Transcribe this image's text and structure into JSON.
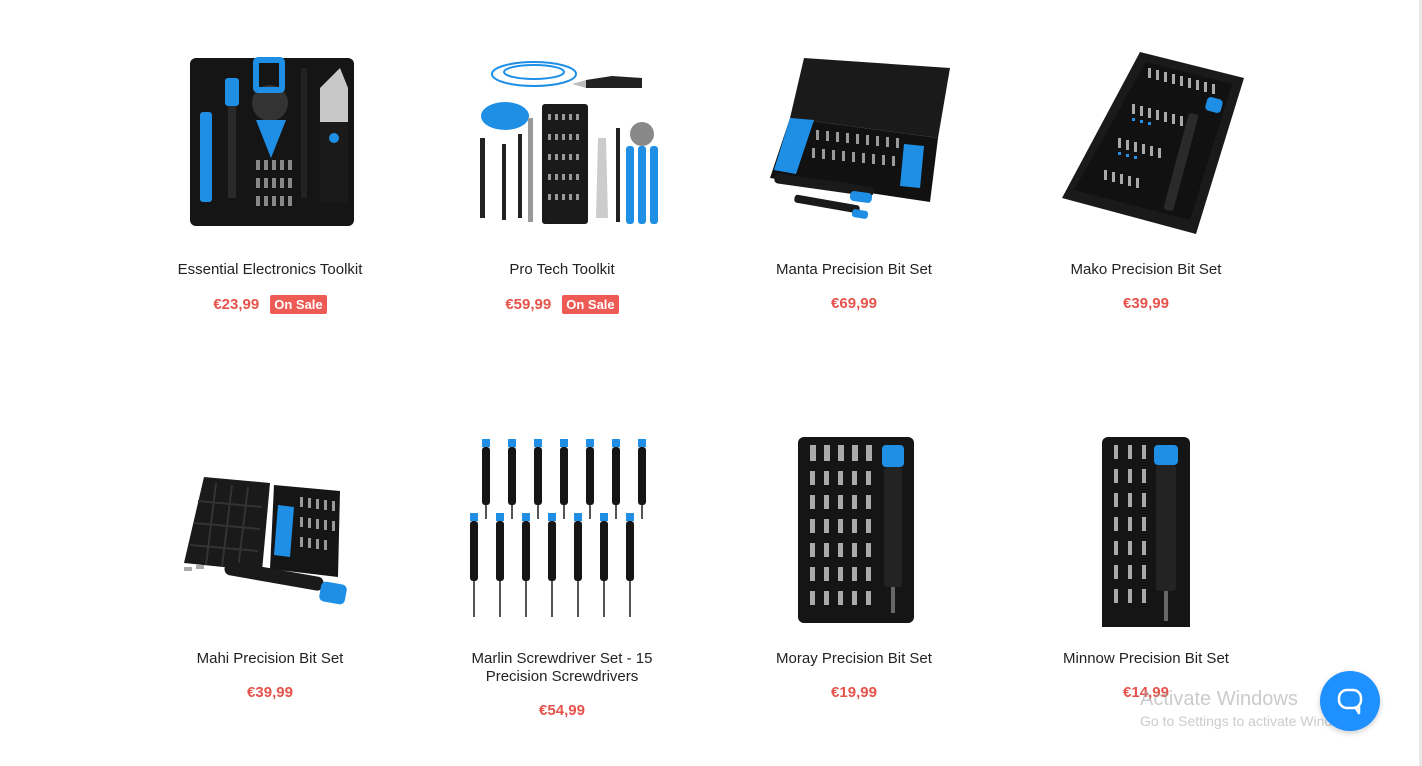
{
  "products": [
    {
      "title": "Essential Electronics Toolkit",
      "price": "€23,99",
      "badge": "On Sale",
      "image": "essential-toolkit"
    },
    {
      "title": "Pro Tech Toolkit",
      "price": "€59,99",
      "badge": "On Sale",
      "image": "pro-tech-toolkit"
    },
    {
      "title": "Manta Precision Bit Set",
      "price": "€69,99",
      "badge": "",
      "image": "manta-bit-set"
    },
    {
      "title": "Mako Precision Bit Set",
      "price": "€39,99",
      "badge": "",
      "image": "mako-bit-set"
    },
    {
      "title": "Mahi Precision Bit Set",
      "price": "€39,99",
      "badge": "",
      "image": "mahi-bit-set"
    },
    {
      "title": "Marlin Screwdriver Set - 15 Precision Screwdrivers",
      "price": "€54,99",
      "badge": "",
      "image": "marlin-screwdriver-set"
    },
    {
      "title": "Moray Precision Bit Set",
      "price": "€19,99",
      "badge": "",
      "image": "moray-bit-set"
    },
    {
      "title": "Minnow Precision Bit Set",
      "price": "€14,99",
      "badge": "",
      "image": "minnow-bit-set"
    }
  ],
  "watermark": {
    "line1": "Activate Windows",
    "line2": "Go to Settings to activate Windows."
  },
  "chat": {
    "icon": "chat-bubble-icon"
  },
  "colors": {
    "price": "#e5534b",
    "badge_bg": "#ee5b55",
    "accent": "#1e90ff",
    "tool_blue": "#1f8fe6"
  }
}
